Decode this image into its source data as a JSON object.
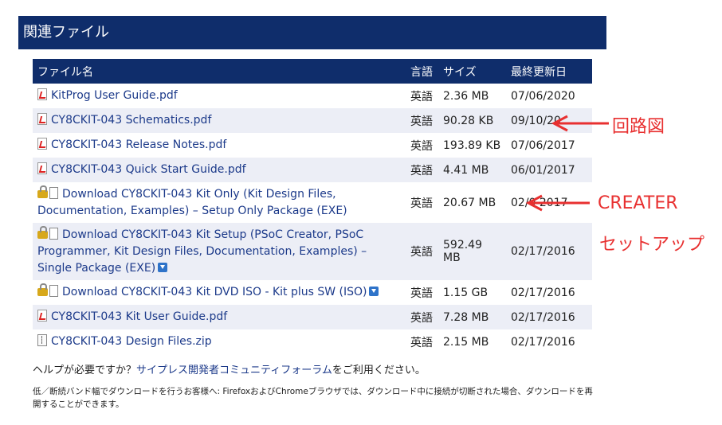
{
  "section": {
    "title": "関連ファイル"
  },
  "table": {
    "headers": {
      "name": "ファイル名",
      "lang": "言語",
      "size": "サイズ",
      "date": "最終更新日"
    },
    "rows": [
      {
        "icon": "pdf-icon",
        "name": "KitProg User Guide.pdf",
        "lang": "英語",
        "size": "2.36 MB",
        "date": "07/06/2020"
      },
      {
        "icon": "pdf-icon",
        "name": "CY8CKIT-043 Schematics.pdf",
        "lang": "英語",
        "size": "90.28 KB",
        "date": "09/10/20"
      },
      {
        "icon": "pdf-icon",
        "name": "CY8CKIT-043 Release Notes.pdf",
        "lang": "英語",
        "size": "193.89 KB",
        "date": "07/06/2017"
      },
      {
        "icon": "pdf-icon",
        "name": "CY8CKIT-043 Quick Start Guide.pdf",
        "lang": "英語",
        "size": "4.41 MB",
        "date": "06/01/2017"
      },
      {
        "icon": "lock-icon",
        "name": "Download CY8CKIT-043 Kit Only (Kit Design Files, Documentation, Examples) – Setup Only Package (EXE)",
        "lang": "英語",
        "size": "20.67 MB",
        "date": "02/0  2017"
      },
      {
        "icon": "lock-icon",
        "name": "Download CY8CKIT-043 Kit Setup (PSoC Creator, PSoC Programmer, Kit Design Files, Documentation, Examples) – Single Package (EXE)",
        "lang": "英語",
        "size": "592.49 MB",
        "date": "02/17/2016"
      },
      {
        "icon": "lock-icon",
        "name": "Download CY8CKIT-043 Kit DVD ISO - Kit plus SW (ISO)",
        "lang": "英語",
        "size": "1.15 GB",
        "date": "02/17/2016"
      },
      {
        "icon": "pdf-icon",
        "name": "CY8CKIT-043 Kit User Guide.pdf",
        "lang": "英語",
        "size": "7.28 MB",
        "date": "02/17/2016"
      },
      {
        "icon": "zip-icon",
        "name": "CY8CKIT-043 Design Files.zip",
        "lang": "英語",
        "size": "2.15 MB",
        "date": "02/17/2016"
      }
    ]
  },
  "help": {
    "prefix": "ヘルプが必要ですか？",
    "link": "サイプレス開発者コミュニティフォーラム",
    "suffix": "をご利用ください。"
  },
  "note": "低／断続バンド幅でダウンロードを行うお客様へ: FirefoxおよびChromeブラウザでは、ダウンロード中に接続が切断された場合、ダウンロードを再開することができます。",
  "annotations": {
    "schematic": "回路図",
    "creater": "CREATER",
    "setup": "セットアップ"
  },
  "colors": {
    "header_bg": "#0f2d6b",
    "annotation": "#e83030",
    "link": "#1c3a8a"
  }
}
